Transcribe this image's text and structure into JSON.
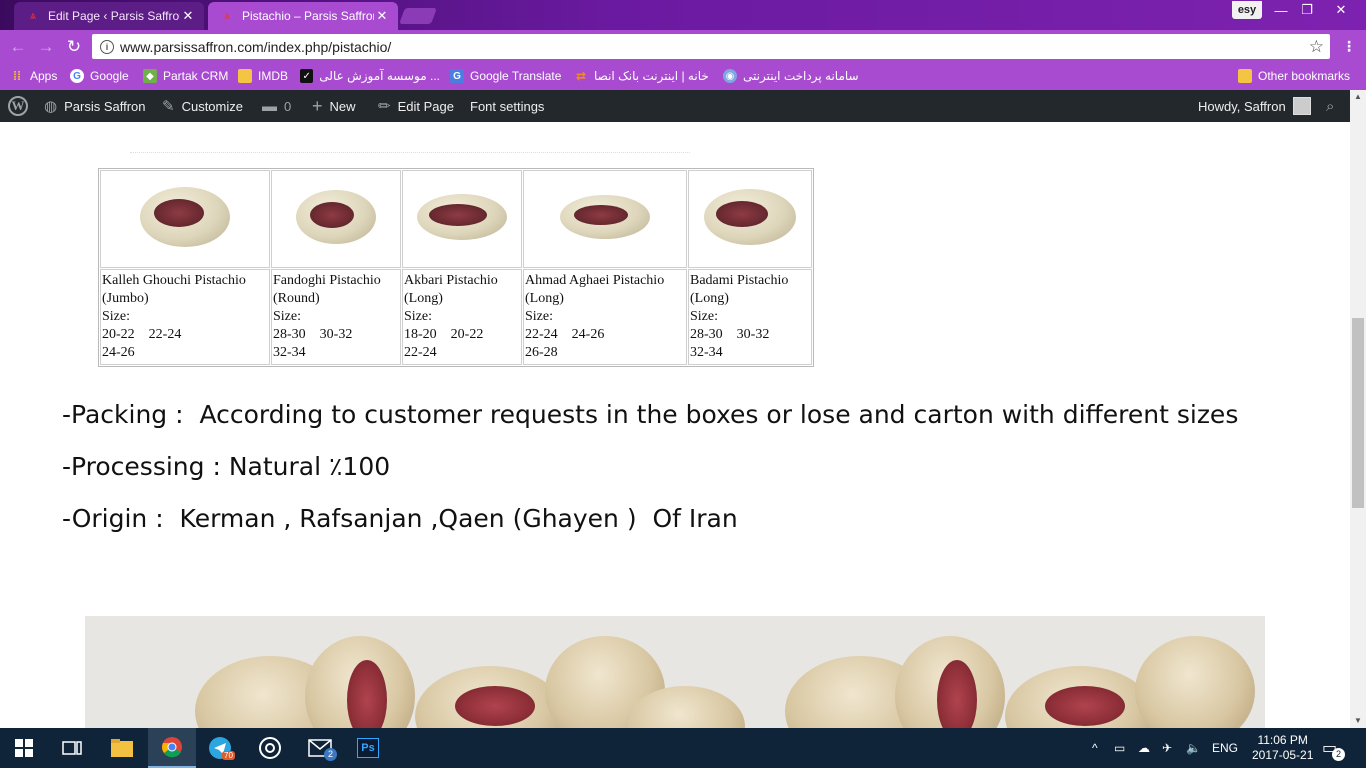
{
  "browser": {
    "tabs": [
      {
        "title": "Edit Page ‹ Parsis Saffron",
        "active": false
      },
      {
        "title": "Pistachio – Parsis Saffron",
        "active": true
      }
    ],
    "profile_label": "esy",
    "url": "www.parsissaffron.com/index.php/pistachio/",
    "bookmarks": [
      {
        "label": "Apps",
        "icon": "apps-grid-icon"
      },
      {
        "label": "Google",
        "icon": "google-icon"
      },
      {
        "label": "Partak CRM",
        "icon": "partak-icon"
      },
      {
        "label": "IMDB",
        "icon": "folder-icon"
      },
      {
        "label": "موسسه آموزش عالی ...",
        "icon": "school-icon"
      },
      {
        "label": "Google Translate",
        "icon": "translate-icon"
      },
      {
        "label": "خانه | اینترنت بانک انصا",
        "icon": "bank-icon"
      },
      {
        "label": "سامانه پرداخت اینترنتی",
        "icon": "payment-icon"
      }
    ],
    "other_bookmarks": "Other bookmarks"
  },
  "adminbar": {
    "site_name": "Parsis Saffron",
    "customize": "Customize",
    "comments_count": "0",
    "new": "New",
    "edit_page": "Edit Page",
    "font_settings": "Font settings",
    "howdy": "Howdy, Saffron"
  },
  "products": [
    {
      "name": "Kalleh Ghouchi Pistachio",
      "type": "(Jumbo)",
      "size_label": "Size:",
      "sizes_line1": "20-22    22-24",
      "sizes_line2": "24-26"
    },
    {
      "name": "Fandoghi Pistachio",
      "type": "(Round)",
      "size_label": "Size:",
      "sizes_line1": "28-30    30-32",
      "sizes_line2": "32-34"
    },
    {
      "name": "Akbari Pistachio",
      "type": "(Long)",
      "size_label": "Size:",
      "sizes_line1": "18-20    20-22",
      "sizes_line2": "22-24"
    },
    {
      "name": "Ahmad Aghaei Pistachio",
      "type": "(Long)",
      "size_label": "Size:",
      "sizes_line1": "22-24    24-26",
      "sizes_line2": "26-28"
    },
    {
      "name": "Badami Pistachio",
      "type": "(Long)",
      "size_label": "Size:",
      "sizes_line1": "28-30    30-32",
      "sizes_line2": "32-34"
    }
  ],
  "info": {
    "packing": "-Packing :  According to customer requests in the boxes or lose and carton with different sizes",
    "processing": "-Processing : Natural ٪100",
    "origin": "-Origin :  Kerman , Rafsanjan ,Qaen (Ghayen )  Of Iran"
  },
  "taskbar": {
    "apps": [
      "windows-start-icon",
      "task-view-icon",
      "file-explorer-icon",
      "chrome-icon",
      "telegram-icon",
      "groove-icon",
      "mail-icon",
      "photoshop-icon"
    ],
    "telegram_badge": "70",
    "mail_badge": "2",
    "language": "ENG",
    "time": "11:06 PM",
    "date": "2017-05-21",
    "notification_count": "2"
  }
}
